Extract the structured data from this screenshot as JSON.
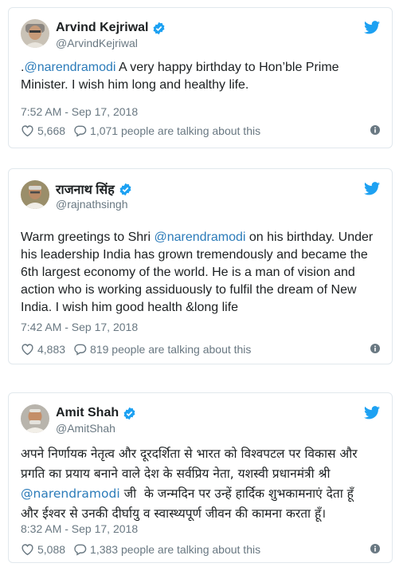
{
  "colors": {
    "link": "#2b7bb9",
    "text": "#1c2022",
    "muted": "#697882",
    "twitter_blue": "#1da1f2",
    "border": "#e1e8ed"
  },
  "icons": {
    "verified": "verified-badge-icon",
    "bird": "twitter-bird-icon",
    "like": "heart-icon",
    "reply": "speech-bubble-icon",
    "info": "info-icon"
  },
  "tweets": [
    {
      "name": "Arvind Kejriwal",
      "handle": "@ArvindKejriwal",
      "text_prefix": ".",
      "mention": "@narendramodi",
      "text_suffix": " A very happy birthday to Hon’ble Prime\nMinister. I wish him long and healthy life.",
      "time": "7:52 AM - Sep 17, 2018",
      "likes": "5,668",
      "talking": "1,071 people are talking about this"
    },
    {
      "name": "राजनाथ सिंह",
      "handle": "@rajnathsingh",
      "text_prefix": "Warm greetings to Shri ",
      "mention": "@narendramodi",
      "text_suffix": " on his birthday. Under\nhis leadership India has grown tremendously and became the\n6th largest economy of the world. He is a man of vision and\naction who is working assiduously to fulfil the dream of New\nIndia. I wish him good health &long life",
      "time": "7:42 AM - Sep 17, 2018",
      "likes": "4,883",
      "talking": "819 people are talking about this"
    },
    {
      "name": "Amit Shah",
      "handle": "@AmitShah",
      "text_prefix": "अपने निर्णायक नेतृत्व और दूरदर्शिता से भारत को विश्वपटल पर विकास और\nप्रगति का प्रयाय बनाने वाले देश के सर्वप्रिय नेता, यशस्वी प्रधानमंत्री श्री\n",
      "mention": "@narendramodi",
      "text_suffix": " जी  के जन्मदिन पर उन्हें हार्दिक शुभकामनाएं देता हूँ\nऔर ईश्वर से उनकी दीर्घायु व स्वास्थ्यपूर्ण जीवन की कामना करता हूँ।",
      "time": "8:32 AM - Sep 17, 2018",
      "likes": "5,088",
      "talking": "1,383 people are talking about this"
    }
  ]
}
